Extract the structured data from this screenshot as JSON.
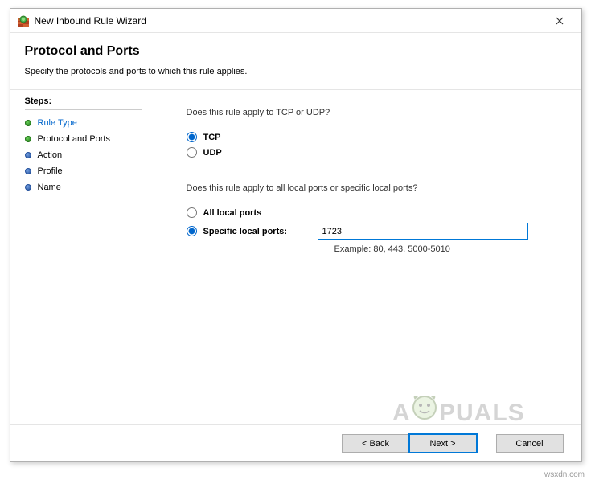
{
  "window": {
    "title": "New Inbound Rule Wizard"
  },
  "header": {
    "title": "Protocol and Ports",
    "subtitle": "Specify the protocols and ports to which this rule applies."
  },
  "sidebar": {
    "heading": "Steps:",
    "items": [
      {
        "label": "Rule Type",
        "state": "done"
      },
      {
        "label": "Protocol and Ports",
        "state": "current"
      },
      {
        "label": "Action",
        "state": "future"
      },
      {
        "label": "Profile",
        "state": "future"
      },
      {
        "label": "Name",
        "state": "future"
      }
    ]
  },
  "content": {
    "q1": "Does this rule apply to TCP or UDP?",
    "tcp_label": "TCP",
    "udp_label": "UDP",
    "q2": "Does this rule apply to all local ports or specific local ports?",
    "all_ports_label": "All local ports",
    "specific_ports_label": "Specific local ports:",
    "port_value": "1723",
    "example": "Example: 80, 443, 5000-5010"
  },
  "buttons": {
    "back": "< Back",
    "next": "Next >",
    "cancel": "Cancel"
  },
  "footer": "wsxdn.com",
  "watermark": "APPUALS"
}
